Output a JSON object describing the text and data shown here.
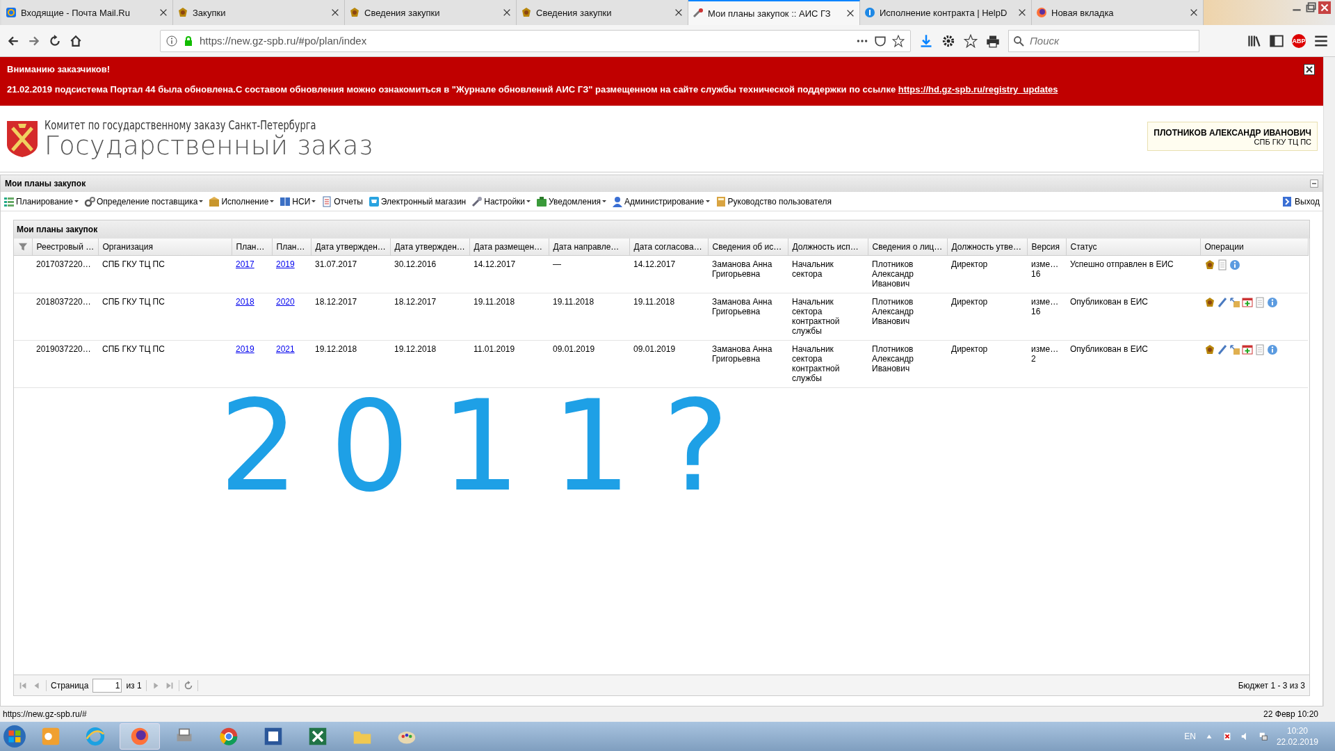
{
  "browser": {
    "tabs": [
      {
        "kind": "mail",
        "title": "Входящие - Почта Mail.Ru",
        "selected": false
      },
      {
        "kind": "emblem",
        "title": "Закупки",
        "selected": false
      },
      {
        "kind": "emblem",
        "title": "Сведения закупки",
        "selected": false
      },
      {
        "kind": "emblem",
        "title": "Сведения закупки",
        "selected": false
      },
      {
        "kind": "tools",
        "title": "Мои планы закупок :: АИС ГЗ",
        "selected": true
      },
      {
        "kind": "help",
        "title": "Исполнение контракта | HelpD",
        "selected": false
      },
      {
        "kind": "firefox",
        "title": "Новая вкладка",
        "selected": false
      }
    ],
    "url": "https://new.gz-spb.ru/#po/plan/index",
    "search": {
      "placeholder": "Поиск"
    },
    "adblock_badge": "ABP"
  },
  "banner": {
    "title": "Вниманию заказчиков!",
    "message": "21.02.2019 подсистема Портал 44 была обновлена.С составом обновления можно ознакомиться в \"Журнале обновлений АИС ГЗ\" размещенном на сайте службы технической поддержки по ссылке",
    "link": "https://hd.gz-spb.ru/registry_updates"
  },
  "header": {
    "committee": "Комитет по государственному заказу Санкт-Петербурга",
    "system": "Государственный заказ",
    "user": {
      "name": "ПЛОТНИКОВ АЛЕКСАНДР ИВАНОВИЧ",
      "org": "СПБ ГКУ ТЦ ПС"
    }
  },
  "panel": {
    "title": "Мои планы закупок"
  },
  "menu": [
    {
      "kind": "plan",
      "label": "Планирование",
      "dropdown": true
    },
    {
      "kind": "gears",
      "label": "Определение поставщика",
      "dropdown": true
    },
    {
      "kind": "box",
      "label": "Исполнение",
      "dropdown": true
    },
    {
      "kind": "book",
      "label": "НСИ",
      "dropdown": true
    },
    {
      "kind": "report",
      "label": "Отчеты",
      "dropdown": false
    },
    {
      "kind": "cart",
      "label": "Электронный магазин",
      "dropdown": false
    },
    {
      "kind": "wrench",
      "label": "Настройки",
      "dropdown": true
    },
    {
      "kind": "bell",
      "label": "Уведомления",
      "dropdown": true
    },
    {
      "kind": "user",
      "label": "Администрирование",
      "dropdown": true
    },
    {
      "kind": "guide",
      "label": "Руководство пользователя",
      "dropdown": false
    }
  ],
  "logout": "Выход",
  "grid": {
    "title": "Мои планы закупок",
    "columns": [
      "Реестровый …",
      "Организация",
      "План…",
      "План…",
      "Дата утвержден…",
      "Дата утвержден…",
      "Дата размещен…",
      "Дата направле…",
      "Дата согласова…",
      "Сведения об ис…",
      "Должность исп…",
      "Сведения о лиц…",
      "Должность утве…",
      "Версия",
      "Статус",
      "Операции"
    ],
    "rows": [
      {
        "registry": "2017037220…",
        "organization": "СПБ ГКУ ТЦ ПС",
        "plans": [
          "2017",
          "2019"
        ],
        "dates": [
          "31.07.2017",
          "30.12.2016",
          "14.12.2017",
          "—",
          "14.12.2017"
        ],
        "executor": "Заманова Анна Григорьевна",
        "executor_position": "Начальник сектора",
        "approver": "Плотников Александр Иванович",
        "approver_position": "Директор",
        "version": "изме…\n16",
        "status": "Успешно отправлен в ЕИС",
        "editable": false
      },
      {
        "registry": "2018037220…",
        "organization": "СПБ ГКУ ТЦ ПС",
        "plans": [
          "2018",
          "2020"
        ],
        "dates": [
          "18.12.2017",
          "18.12.2017",
          "19.11.2018",
          "19.11.2018",
          "19.11.2018"
        ],
        "executor": "Заманова Анна Григорьевна",
        "executor_position": "Начальник сектора контрактной службы",
        "approver": "Плотников Александр Иванович",
        "approver_position": "Директор",
        "version": "изме…\n16",
        "status": "Опубликован в ЕИС",
        "editable": true
      },
      {
        "registry": "2019037220…",
        "organization": "СПБ ГКУ ТЦ ПС",
        "plans": [
          "2019",
          "2021"
        ],
        "dates": [
          "19.12.2018",
          "19.12.2018",
          "11.01.2019",
          "09.01.2019",
          "09.01.2019"
        ],
        "executor": "Заманова Анна Григорьевна",
        "executor_position": "Начальник сектора контрактной службы",
        "approver": "Плотников Александр Иванович",
        "approver_position": "Директор",
        "version": "изме…\n2",
        "status": "Опубликован в ЕИС",
        "editable": true
      }
    ],
    "pager": {
      "page_label": "Страница",
      "page": "1",
      "of": "из 1",
      "summary": "Бюджет 1 - 3 из 3"
    }
  },
  "annotation": "2011?",
  "status": {
    "url": "https://new.gz-spb.ru/#",
    "datetime": "22 Февр 10:20"
  },
  "taskbar": {
    "apps": [
      {
        "kind": "outlook",
        "selected": false
      },
      {
        "kind": "ie",
        "selected": false
      },
      {
        "kind": "firefox",
        "selected": true
      },
      {
        "kind": "printer",
        "selected": false
      },
      {
        "kind": "chrome",
        "selected": false
      },
      {
        "kind": "word",
        "selected": false
      },
      {
        "kind": "excel",
        "selected": false
      },
      {
        "kind": "folder",
        "selected": false
      },
      {
        "kind": "paint",
        "selected": false
      }
    ],
    "language": "EN",
    "time": "10:20",
    "date": "22.02.2019"
  }
}
